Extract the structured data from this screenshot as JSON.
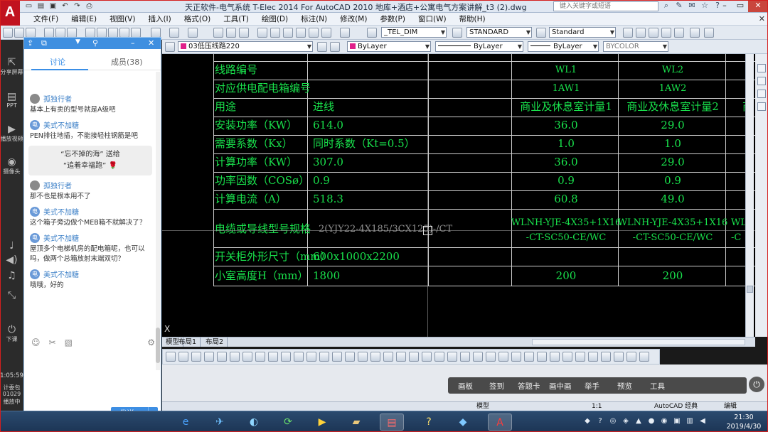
{
  "window": {
    "title": "天正软件-电气系统 T-Elec 2014  For AutoCAD 2010   地库+酒店+公寓电气方案讲解_t3 (2).dwg",
    "search_placeholder": "键入关键字或短语"
  },
  "menu": [
    "文件(F)",
    "编辑(E)",
    "视图(V)",
    "插入(I)",
    "格式(O)",
    "工具(T)",
    "绘图(D)",
    "标注(N)",
    "修改(M)",
    "参数(P)",
    "窗口(W)",
    "帮助(H)"
  ],
  "toolbar": {
    "dim_style": "_TEL_DIM",
    "text_style": "STANDARD",
    "table_style": "Standard",
    "layer": "03低压线路220",
    "color": "ByLayer",
    "linetype": "ByLayer",
    "lineweight": "ByLayer",
    "plotstyle": "BYCOLOR"
  },
  "colors": {
    "layer_swatch": "#e0208a",
    "text_green": "#19e24c",
    "accent_blue": "#3d8ee3"
  },
  "chat": {
    "tab_discuss": "讨论",
    "tab_members": "成员(38)",
    "messages": [
      {
        "user": "孤独行者",
        "text": "基本上有卖的型号就是A级吧"
      },
      {
        "user": "美式不加糖",
        "text": "PEN排往地插，不能接轻柱钢筋是吧"
      },
      {
        "user": "孤独行者",
        "text": "那不也是根本用不了"
      },
      {
        "user": "美式不加糖",
        "text": "这个箱子旁边做个MEB箱不就解决了？"
      },
      {
        "user": "美式不加糖",
        "text": "屋顶多个电梯机房的配电箱呢，也可以吗，做两个总箱放射末端双切？"
      },
      {
        "user": "美式不加糖",
        "text": "哦哦，好的"
      }
    ],
    "gift_line1": "“忘不掉的海” 送给",
    "gift_line2": "“追着幸福跑” 🌹",
    "send_label": "发送",
    "avatar_letter": "电"
  },
  "sidebar": {
    "share_label": "分享屏幕",
    "ppt_label": "PPT",
    "video_label": "播放视频",
    "camera_label": "摄像头",
    "end_label": "下课",
    "time": "1:05:59",
    "counter_label": "计委包",
    "counter_value": "01029",
    "status_label": "播放中"
  },
  "table": {
    "rows": [
      {
        "label": "线路编号",
        "in": "",
        "c1": "WL1",
        "c2": "WL2"
      },
      {
        "label": "对应供电配电箱编号",
        "in": "",
        "c1": "1AW1",
        "c2": "1AW2"
      },
      {
        "label": "用途",
        "in": "进线",
        "c1": "商业及休息室计量1",
        "c2": "商业及休息室计量2",
        "c3": "商"
      },
      {
        "label": "安装功率（KW）",
        "in": "614.0",
        "c1": "36.0",
        "c2": "29.0"
      },
      {
        "label": "需要系数（Kx）",
        "in": "同时系数（Kt=0.5）",
        "c1": "1.0",
        "c2": "1.0"
      },
      {
        "label": "计算功率（KW）",
        "in": "307.0",
        "c1": "36.0",
        "c2": "29.0"
      },
      {
        "label": "功率因数（COSø）",
        "in": "0.9",
        "c1": "0.9",
        "c2": "0.9"
      },
      {
        "label": "计算电流（A）",
        "in": "518.3",
        "c1": "60.8",
        "c2": "49.0"
      },
      {
        "label": "电缆或导线型号规格",
        "in": "2(YJY22-4X185/3CX125)-/CT",
        "c1a": "WLNH-YJE-4X35+1X16",
        "c1b": "-CT-SC50-CE/WC",
        "c2a": "WLNH-YJE-4X35+1X16",
        "c2b": "-CT-SC50-CE/WC",
        "c3a": "WL",
        "c3b": "-C"
      },
      {
        "label": "开关柜外形尺寸（mm）",
        "in": "600x1000x2200",
        "c1": "",
        "c2": ""
      },
      {
        "label": "小室高度H（mm）",
        "in": "1800",
        "c1": "200",
        "c2": "200"
      }
    ]
  },
  "drawing": {
    "axis_label": "X"
  },
  "layout_tabs": [
    "模型",
    "布局1",
    "布局2"
  ],
  "live": {
    "items": [
      "画板",
      "签到",
      "答题卡",
      "画中画",
      "举手",
      "预览",
      "工具"
    ]
  },
  "status": {
    "model": "模型",
    "scale": "1:1",
    "autocad": "AutoCAD 经典",
    "edit": "编辑"
  },
  "clock": {
    "time": "21:30",
    "date": "2019/4/30"
  }
}
